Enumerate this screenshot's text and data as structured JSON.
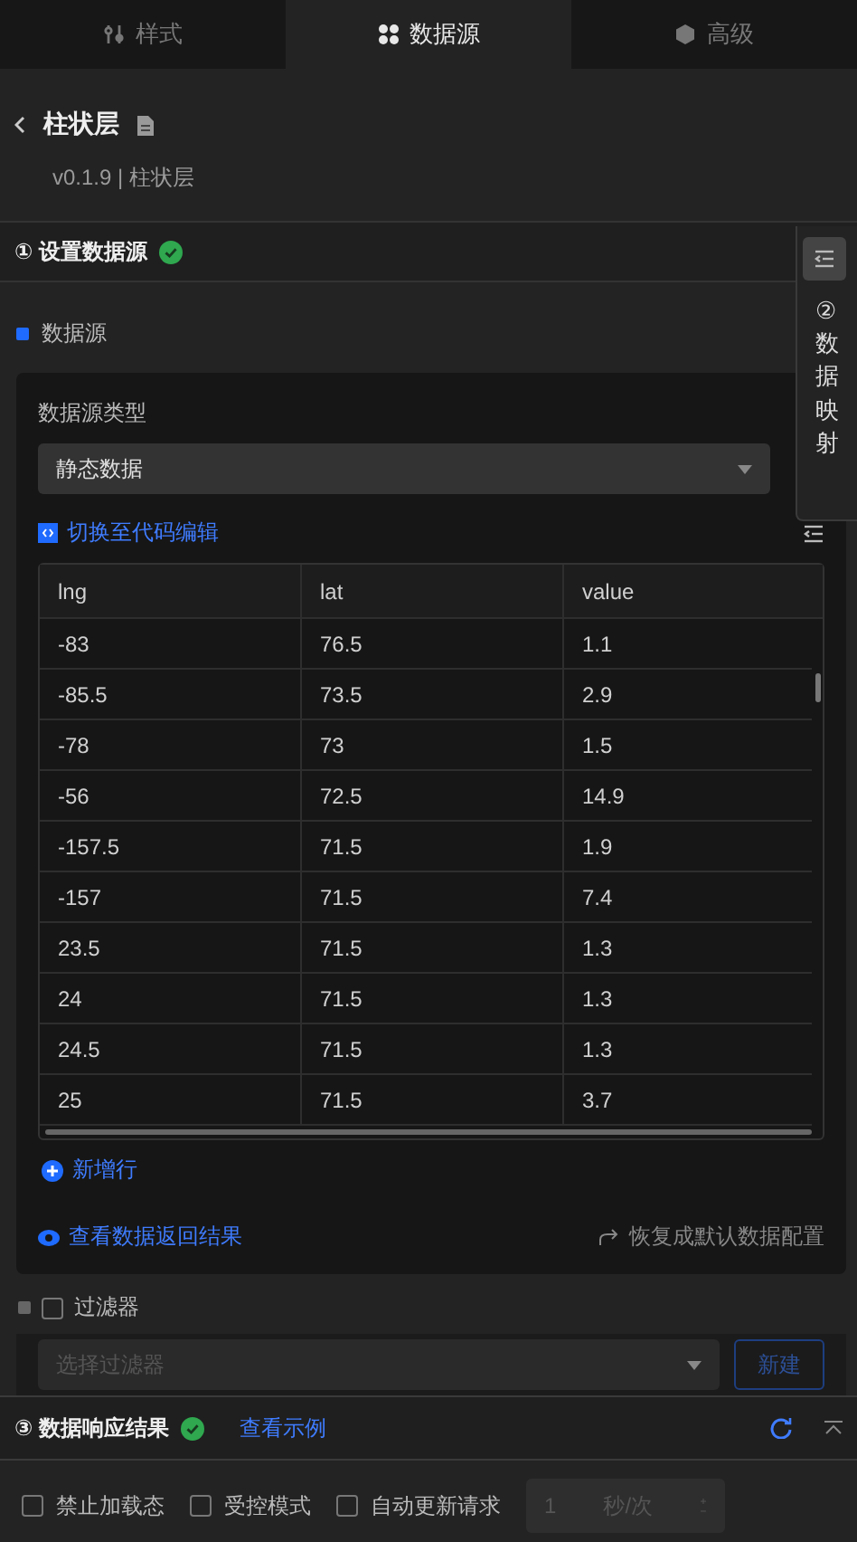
{
  "tabs": [
    {
      "label": "样式",
      "selected": false
    },
    {
      "label": "数据源",
      "selected": true
    },
    {
      "label": "高级",
      "selected": false
    }
  ],
  "header": {
    "title": "柱状层",
    "subtitle": "v0.1.9 | 柱状层"
  },
  "section_1": {
    "title": "① 设置数据源",
    "done": true
  },
  "side_tab": {
    "label": "②数据映射"
  },
  "datasource": {
    "label": "数据源",
    "type_label": "数据源类型",
    "type_value": "静态数据",
    "code_link": "切换至代码编辑",
    "table": {
      "columns": [
        "lng",
        "lat",
        "value"
      ],
      "rows": [
        [
          "-83",
          "76.5",
          "1.1"
        ],
        [
          "-85.5",
          "73.5",
          "2.9"
        ],
        [
          "-78",
          "73",
          "1.5"
        ],
        [
          "-56",
          "72.5",
          "14.9"
        ],
        [
          "-157.5",
          "71.5",
          "1.9"
        ],
        [
          "-157",
          "71.5",
          "7.4"
        ],
        [
          "23.5",
          "71.5",
          "1.3"
        ],
        [
          "24",
          "71.5",
          "1.3"
        ],
        [
          "24.5",
          "71.5",
          "1.3"
        ],
        [
          "25",
          "71.5",
          "3.7"
        ]
      ]
    },
    "add_row": "新增行",
    "view_result": "查看数据返回结果",
    "reset": "恢复成默认数据配置"
  },
  "filter": {
    "label": "过滤器",
    "checked": false,
    "placeholder": "选择过滤器",
    "new_button": "新建"
  },
  "section_3": {
    "title": "③ 数据响应结果",
    "done": true,
    "example_link": "查看示例",
    "options": [
      {
        "label": "禁止加载态",
        "checked": false
      },
      {
        "label": "受控模式",
        "checked": false
      },
      {
        "label": "自动更新请求",
        "checked": false
      }
    ],
    "interval": {
      "value": "1",
      "unit": "秒/次"
    }
  }
}
